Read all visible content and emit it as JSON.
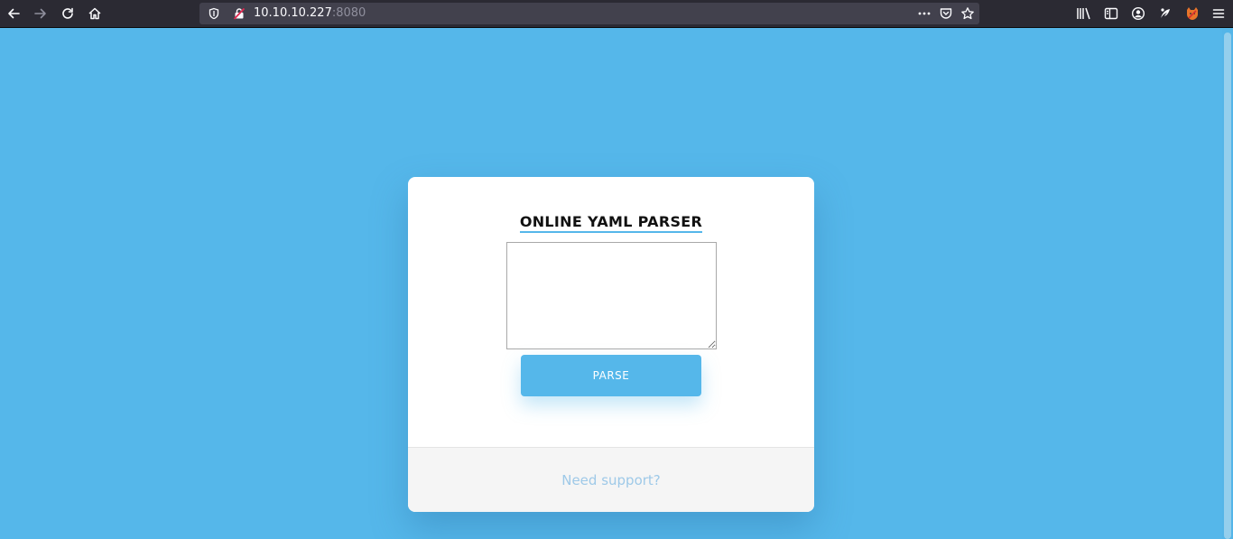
{
  "browser": {
    "url_host": "10.10.10.227",
    "url_port": ":8080"
  },
  "page": {
    "title": "ONLINE YAML PARSER",
    "textarea_value": "",
    "parse_button": "PARSE",
    "support_link": "Need support?"
  },
  "colors": {
    "background": "#55b7ea",
    "accent": "#55b7ea",
    "card": "#ffffff",
    "footer": "#f5f5f5",
    "link": "#9ec9e8"
  }
}
